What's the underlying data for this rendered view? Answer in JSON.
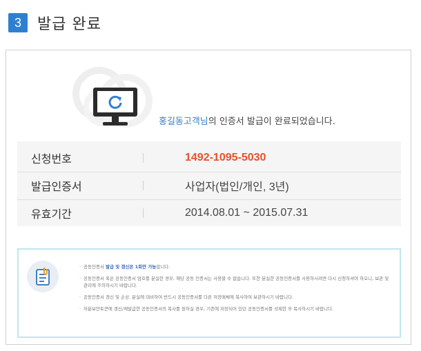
{
  "step": {
    "number": "3",
    "title": "발급 완료"
  },
  "hero": {
    "user_name": "홍길동고객님",
    "message_suffix": "의 인증서 발급이 완료되었습니다."
  },
  "info": {
    "rows": [
      {
        "label": "신청번호",
        "value": "1492-1095-5030"
      },
      {
        "label": "발급인증서",
        "value": "사업자(법인/개인, 3년)"
      },
      {
        "label": "유효기간",
        "value": "2014.08.01 ~ 2015.07.31"
      }
    ]
  },
  "notice": {
    "item1_prefix": "공동인증서 ",
    "item1_highlight": "발급 및 갱신은 1회만 가능",
    "item1_suffix": "합니다.",
    "item2": "공동인증서 혹은 공동인증서 암호를 분실한 경우, 해당 공동 인증서는 사용할 수 없습니다. 또한 분실한 공동인증서를 사용하시려면 다시 신청하셔야 하오니, 보관 및 관리에 주의하시기 바랍니다.",
    "item3": "공동인증서 갱신 및 손상, 분실에 대비하여 반드시 공동인증서를 다른 저장매체에 복사하여 보관하시기 바랍니다.",
    "item4": "차분보안토큰에 갱신/재발급한 공동인증서의 복사를 원하실 경우, 기존에 저장되어 있던 공동인증서를 삭제한 후 복사하시기 바랍니다."
  },
  "colors": {
    "badge": "#2f7fd1",
    "accent": "#e8502a",
    "link": "#3a7ec6",
    "notice_border": "#bfe6ef"
  },
  "icons": {
    "monitor": "monitor-refresh-icon",
    "notice": "document-clip-icon"
  }
}
